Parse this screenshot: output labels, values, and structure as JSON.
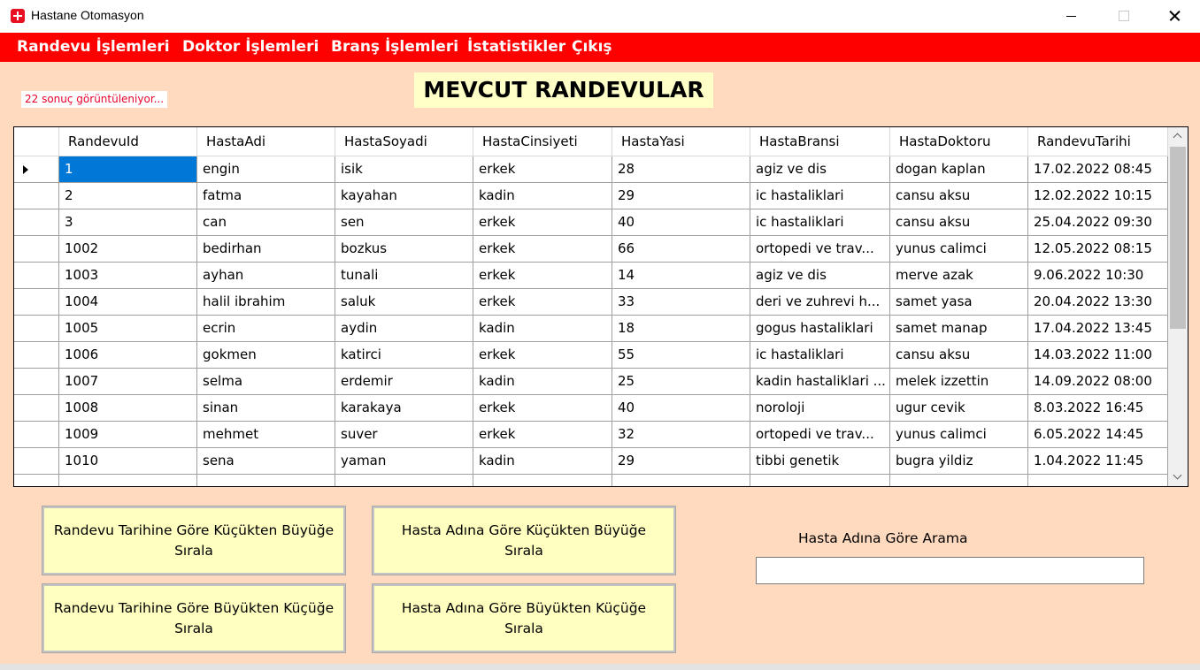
{
  "window": {
    "title": "Hastane Otomasyon"
  },
  "menu": {
    "items": [
      "Randevu İşlemleri",
      "Doktor İşlemleri",
      "Branş İşlemleri",
      "İstatistikler",
      "Çıkış"
    ]
  },
  "result_count": "22  sonuç görüntüleniyor...",
  "page_title": "MEVCUT RANDEVULAR",
  "grid": {
    "columns": [
      "RandevuId",
      "HastaAdi",
      "HastaSoyadi",
      "HastaCinsiyeti",
      "HastaYasi",
      "HastaBransi",
      "HastaDoktoru",
      "RandevuTarihi"
    ],
    "selected_row": 0,
    "rows": [
      [
        "1",
        "engin",
        "isik",
        "erkek",
        "28",
        "agiz ve dis",
        "dogan kaplan",
        "17.02.2022 08:45"
      ],
      [
        "2",
        "fatma",
        "kayahan",
        "kadin",
        "29",
        "ic hastaliklari",
        "cansu aksu",
        "12.02.2022 10:15"
      ],
      [
        "3",
        "can",
        "sen",
        "erkek",
        "40",
        "ic hastaliklari",
        "cansu aksu",
        "25.04.2022 09:30"
      ],
      [
        "1002",
        "bedirhan",
        "bozkus",
        "erkek",
        "66",
        "ortopedi ve trav...",
        "yunus calimci",
        "12.05.2022 08:15"
      ],
      [
        "1003",
        "ayhan",
        "tunali",
        "erkek",
        "14",
        "agiz ve dis",
        "merve azak",
        "9.06.2022 10:30"
      ],
      [
        "1004",
        "halil ibrahim",
        "saluk",
        "erkek",
        "33",
        "deri ve zuhrevi h...",
        "samet yasa",
        "20.04.2022 13:30"
      ],
      [
        "1005",
        "ecrin",
        "aydin",
        "kadin",
        "18",
        "gogus hastaliklari",
        "samet manap",
        "17.04.2022 13:45"
      ],
      [
        "1006",
        "gokmen",
        "katirci",
        "erkek",
        "55",
        "ic hastaliklari",
        "cansu aksu",
        "14.03.2022 11:00"
      ],
      [
        "1007",
        "selma",
        "erdemir",
        "kadin",
        "25",
        "kadin hastaliklari ...",
        "melek izzettin",
        "14.09.2022 08:00"
      ],
      [
        "1008",
        "sinan",
        "karakaya",
        "erkek",
        "40",
        "noroloji",
        "ugur cevik",
        "8.03.2022 16:45"
      ],
      [
        "1009",
        "mehmet",
        "suver",
        "erkek",
        "32",
        "ortopedi ve trav...",
        "yunus calimci",
        "6.05.2022 14:45"
      ],
      [
        "1010",
        "sena",
        "yaman",
        "kadin",
        "29",
        "tibbi genetik",
        "bugra yildiz",
        "1.04.2022 11:45"
      ]
    ]
  },
  "buttons": {
    "sort_date_asc": "Randevu Tarihine Göre Küçükten Büyüğe Sırala",
    "sort_date_desc": "Randevu Tarihine Göre Büyükten Küçüğe Sırala",
    "sort_name_asc": "Hasta Adına Göre Küçükten Büyüğe Sırala",
    "sort_name_desc": "Hasta Adına Göre Büyükten Küçüğe Sırala"
  },
  "search": {
    "label": "Hasta Adına Göre Arama",
    "value": "",
    "placeholder": ""
  },
  "colors": {
    "menu_bar": "#ff0000",
    "background": "#ffdabf",
    "button_bg": "#ffffc0",
    "title_bg": "#ffffc8",
    "selection": "#0078d7",
    "result_count_text": "#e8002a"
  },
  "icons": {
    "app": "hospital-icon",
    "minimize": "minimize-icon",
    "maximize": "maximize-icon",
    "close": "close-icon",
    "row_indicator": "row-pointer-icon"
  }
}
